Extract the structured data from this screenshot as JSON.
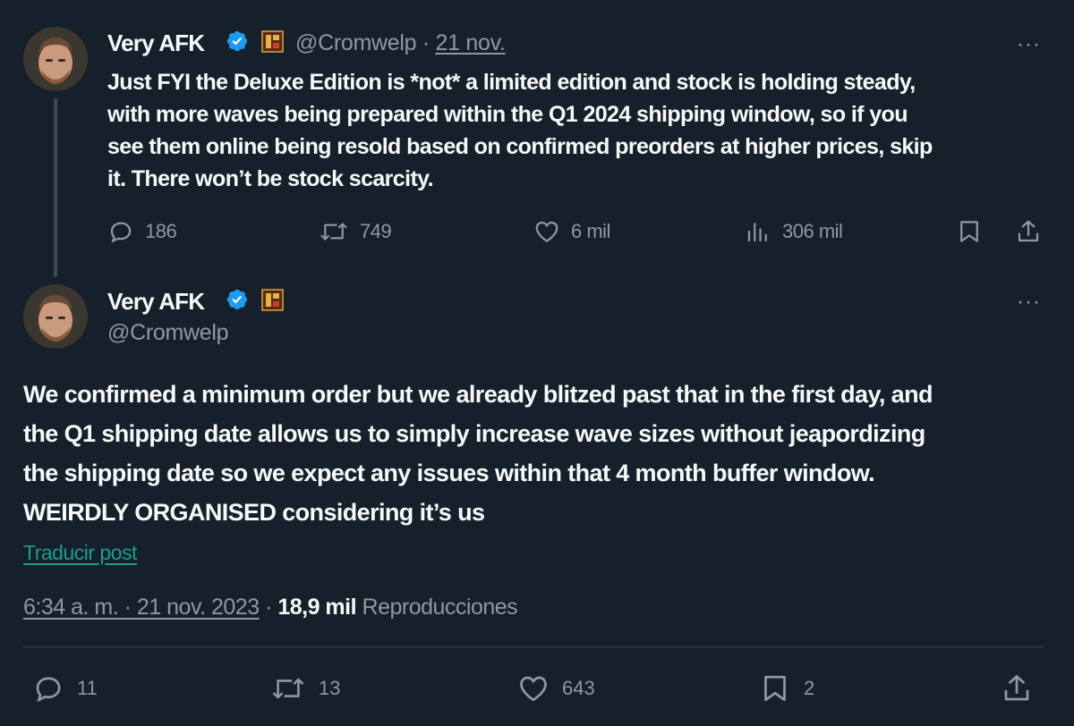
{
  "colors": {
    "background": "#15202b",
    "text": "#f7f9f9",
    "muted": "#8b98a5",
    "verified": "#1d9bf0",
    "translate_link": "#1d9b8f",
    "divider": "#38444d"
  },
  "tweet1": {
    "author_name": "Very AFK",
    "handle": "@Cromwelp",
    "separator": " · ",
    "date": "21 nov.",
    "more_label": "···",
    "text_lines": [
      "Just FYI the Deluxe Edition is *not* a limited edition and stock is holding steady,",
      "with more waves being prepared within the Q1 2024 shipping window, so if you",
      "see them online being resold based on confirmed preorders at higher prices, skip",
      "it. There won’t be stock scarcity."
    ],
    "actions": {
      "replies": "186",
      "reposts": "749",
      "likes": "6 mil",
      "views": "306 mil"
    },
    "icons": {
      "verified": "verified-badge-icon",
      "game": "game-affiliate-icon",
      "reply": "reply-icon",
      "repost": "repost-icon",
      "like": "heart-icon",
      "views": "analytics-icon",
      "bookmark": "bookmark-icon",
      "share": "share-icon"
    }
  },
  "tweet2": {
    "author_name": "Very AFK",
    "handle": "@Cromwelp",
    "more_label": "···",
    "text_lines": [
      "We confirmed a minimum order but we already blitzed past that in the first day, and",
      "the Q1 shipping date allows us to simply increase wave sizes without jeapordizing",
      "the shipping date so we expect any issues within that 4 month buffer window.",
      "WEIRDLY ORGANISED considering it’s us"
    ],
    "translate_label": "Traducir post",
    "timestamp": "6:34 a. m. · 21 nov. 2023",
    "meta_separator": " · ",
    "views_count": "18,9 mil",
    "views_label": " Reproducciones",
    "actions": {
      "replies": "11",
      "reposts": "13",
      "likes": "643",
      "bookmarks": "2"
    }
  }
}
